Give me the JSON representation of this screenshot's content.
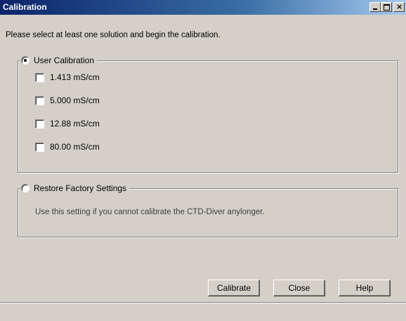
{
  "window": {
    "title": "Calibration",
    "controls": {
      "minimize": "_",
      "maximize": "□",
      "close": "×"
    }
  },
  "instruction": "Please select at least one solution and begin the calibration.",
  "user_calibration": {
    "label": "User Calibration",
    "selected": true,
    "options": [
      {
        "label": "1.413  mS/cm",
        "checked": false
      },
      {
        "label": "5.000  mS/cm",
        "checked": false
      },
      {
        "label": "12.88  mS/cm",
        "checked": false
      },
      {
        "label": "80.00  mS/cm",
        "checked": false
      }
    ]
  },
  "factory": {
    "label": "Restore Factory Settings",
    "selected": false,
    "note": "Use this setting if you cannot calibrate the CTD-Diver anylonger."
  },
  "buttons": {
    "calibrate": "Calibrate",
    "close": "Close",
    "help": "Help"
  }
}
